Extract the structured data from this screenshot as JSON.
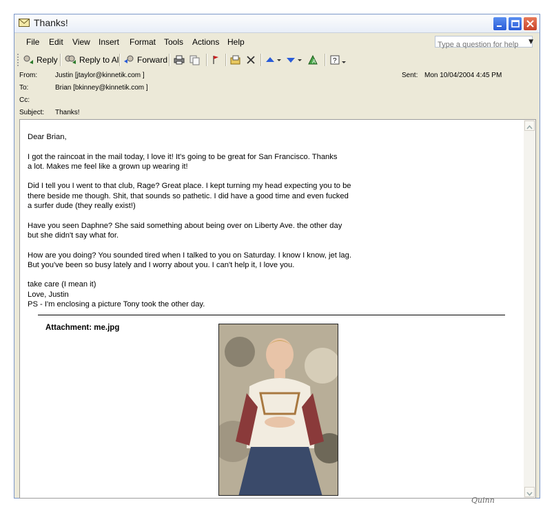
{
  "window": {
    "title": "Thanks!"
  },
  "menu": {
    "items": [
      "File",
      "Edit",
      "View",
      "Insert",
      "Format",
      "Tools",
      "Actions",
      "Help"
    ],
    "help_placeholder": "Type a question for help"
  },
  "toolbar": {
    "reply": "Reply",
    "reply_all": "Reply to All",
    "forward": "Forward"
  },
  "header": {
    "from_label": "From:",
    "from_value": "Justin [jtaylor@kinnetik.com ]",
    "sent_label": "Sent:",
    "sent_value": "Mon 10/04/2004 4:45 PM",
    "to_label": "To:",
    "to_value": "Brian [bkinney@kinnetik.com ]",
    "cc_label": "Cc:",
    "cc_value": "",
    "subject_label": "Subject:",
    "subject_value": "Thanks!"
  },
  "body": {
    "greeting": " Dear Brian,",
    "p1": "  I got the raincoat in the mail today, I love it! It's going to be great for San Francisco.  Thanks\na lot. Makes me feel like a grown up wearing it!",
    "p2": " Did I tell you I went to that club, Rage? Great place. I kept turning my head expecting you to be\nthere beside me though. Shit, that sounds so pathetic. I did have a good time and even fucked\na surfer dude (they really exist!)",
    "p3": " Have you seen Daphne? She said something about being over on Liberty Ave. the other day\nbut she didn't say what for.",
    "p4": " How are you doing? You sounded tired when I talked to you on Saturday. I know I know, jet lag.\nBut you've been so busy lately and I worry about you. I can't help it, I love you.",
    "closing": "take care (I mean it)\nLove, Justin\nPS - I'm enclosing a picture Tony took the other day."
  },
  "attachment": {
    "label": "Attachment: me.jpg"
  },
  "signature": "Quinn",
  "colors": {
    "window_bg": "#ece9d8",
    "title_blue": "#2a5cd8",
    "close_red": "#c8442a"
  }
}
